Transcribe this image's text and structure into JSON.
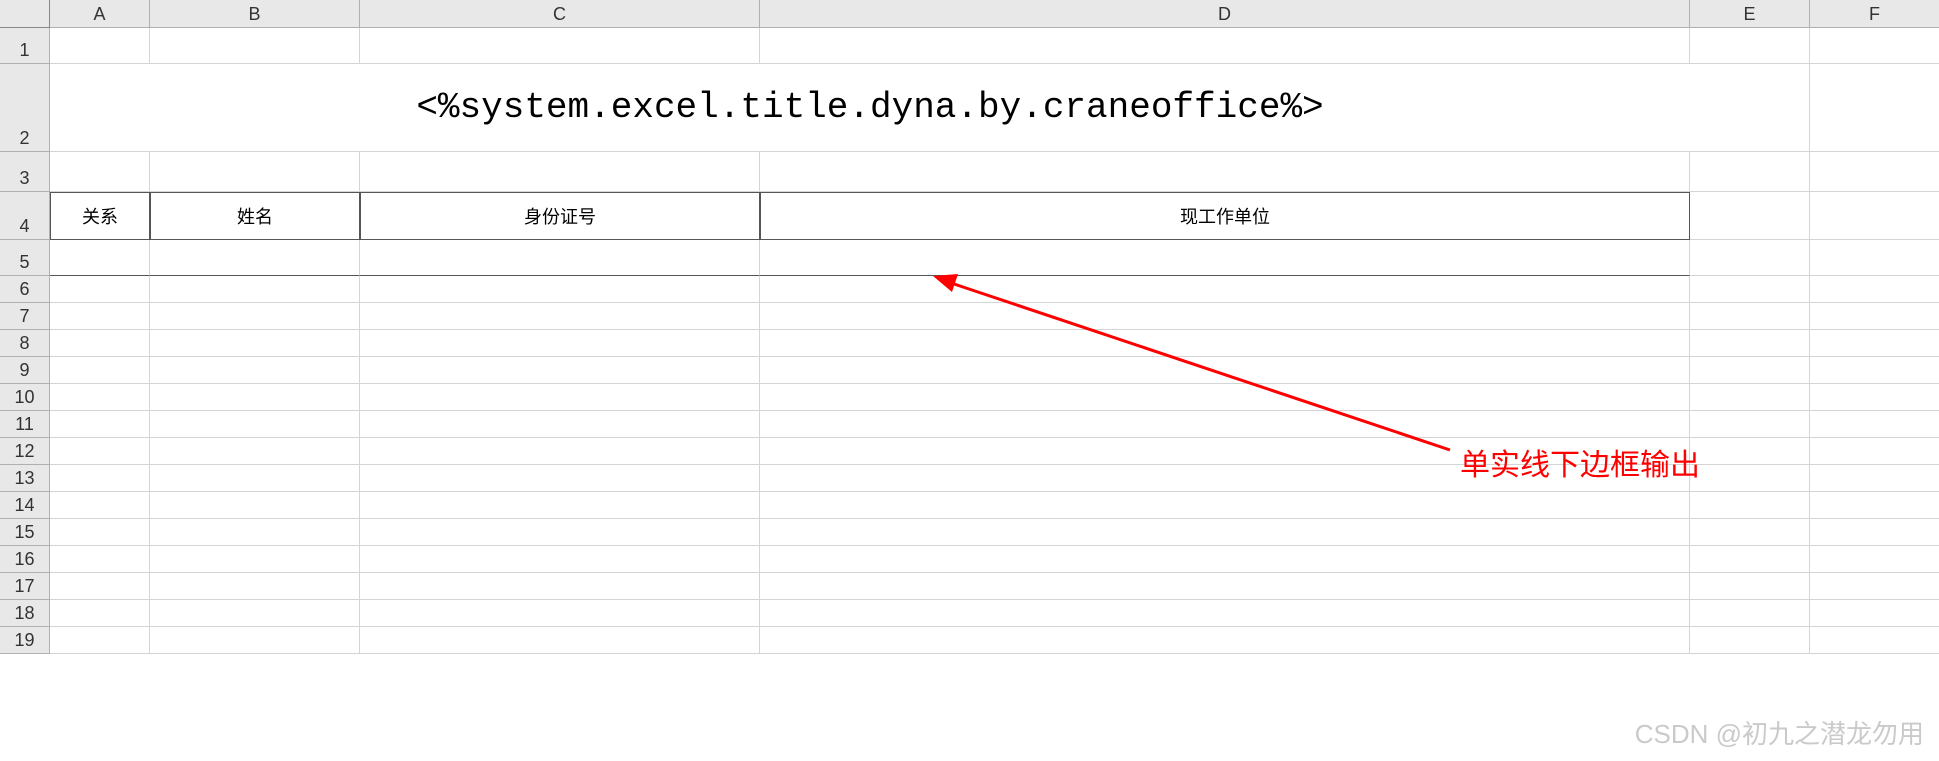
{
  "columns": [
    "A",
    "B",
    "C",
    "D",
    "E",
    "F"
  ],
  "rows": [
    "1",
    "2",
    "3",
    "4",
    "5",
    "6",
    "7",
    "8",
    "9",
    "10",
    "11",
    "12",
    "13",
    "14",
    "15",
    "16",
    "17",
    "18",
    "19"
  ],
  "title": "<%system.excel.title.dyna.by.craneoffice%>",
  "table_headers": {
    "a": "关系",
    "b": "姓名",
    "c": "身份证号",
    "d": "现工作单位"
  },
  "annotation": "单实线下边框输出",
  "watermark": "CSDN @初九之潜龙勿用"
}
